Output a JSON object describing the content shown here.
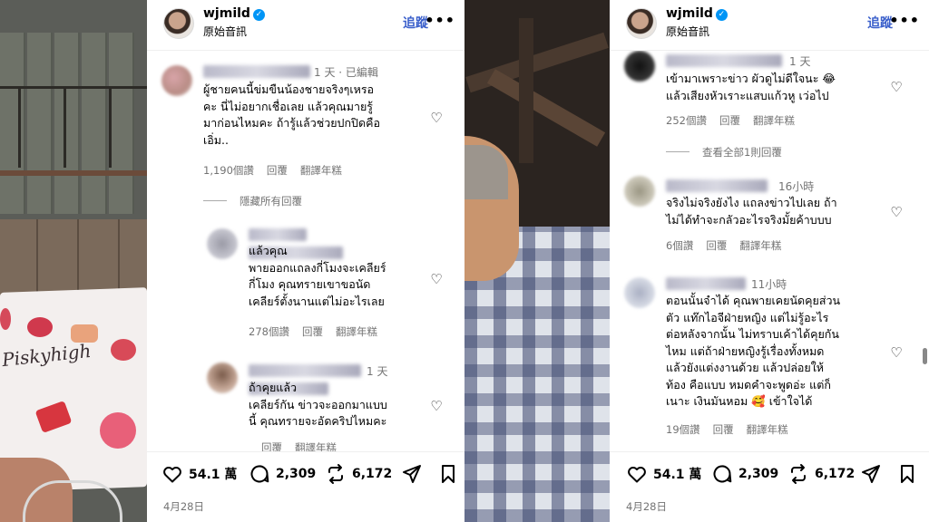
{
  "left_panel": {
    "header": {
      "username": "wjmild",
      "audio_label": "原始音訊",
      "follow_label": "追蹤",
      "more_label": "•••"
    },
    "comments": [
      {
        "time": "1 天 · 已編輯",
        "text": "ผู้ชายคนนี้ข่มขืนน้องชายจริงๆเหรอ\nคะ นี่ไม่อยากเชื่อเลย แล้วคุณมายรู้\nมาก่อนไหมคะ ถ้ารู้แล้วช่วยปกปิดคือ\nเอิ่ม..",
        "likes": "1,190個讚",
        "reply_label": "回覆",
        "translate_label": "翻譯年糕"
      }
    ],
    "thread_link": "隱藏所有回覆",
    "replies": [
      {
        "time": "",
        "text": "แล้วคุณ\nพายออกแถลงกี่โมงจะเคลียร์\nกี่โมง คุณทรายเขาขอนัด\nเคลียร์ตั้งนานแต่ไม่อะไรเลย",
        "likes": "278個讚",
        "reply_label": "回覆",
        "translate_label": "翻譯年糕"
      },
      {
        "time": "1 天",
        "text": "ถ้าคุยแล้ว\nเคลียร์กัน ข่าวจะออกมาแบบ\nนี้ คุณทรายจะอัดคริปไหมคะ",
        "likes": "",
        "reply_label": "回覆",
        "translate_label": "翻譯年糕"
      }
    ],
    "actions": {
      "likes": "54.1 萬",
      "comments": "2,309",
      "reposts": "6,172"
    },
    "date": "4月28日"
  },
  "right_panel": {
    "header": {
      "username": "wjmild",
      "audio_label": "原始音訊",
      "follow_label": "追蹤",
      "more_label": "•••"
    },
    "comments": [
      {
        "time": "1 天",
        "text": "เข้ามาเพราะข่าว ผัวดูไม่ดีใจนะ 😂\nแล้วเสียงหัวเราะแสบแก้วหู เว่อไป",
        "likes": "252個讚",
        "reply_label": "回覆",
        "translate_label": "翻譯年糕"
      },
      {
        "time": "16小時",
        "text": "จริงไม่จริงยังไง แถลงข่าวไปเลย ถ้า\nไม่ได้ทำจะกลัวอะไรจริงมั้ยค้าบบบ",
        "likes": "6個讚",
        "reply_label": "回覆",
        "translate_label": "翻譯年糕"
      },
      {
        "time": "11小時",
        "text": "ตอนนั้นจำได้ คุณพายเคยนัดคุยส่วน\nตัว แท๊กไอจีฝ่ายหญิง แต่ไม่รู้อะไร\nต่อหลังจากนั้น ไม่ทราบเค้าได้คุยกัน\nไหม แต่ถ้าฝ่ายหญิงรู้เรื่องทั้งหมด\nแล้วยังแต่งงานด้วย แล้วปล่อยให้\nท้อง คือแบบ หมดคำจะพูดอ่ะ แต่ก็\nเนาะ เงินมันหอม 🥰 เข้าใจได้",
        "likes": "19個讚",
        "reply_label": "回覆",
        "translate_label": "翻譯年糕"
      }
    ],
    "thread_link": "查看全部1則回覆",
    "actions": {
      "likes": "54.1 萬",
      "comments": "2,309",
      "reposts": "6,172"
    },
    "date": "4月28日"
  },
  "colors": {
    "link": "#3a5fcb",
    "meta": "#737373",
    "verified": "#0095f6"
  }
}
